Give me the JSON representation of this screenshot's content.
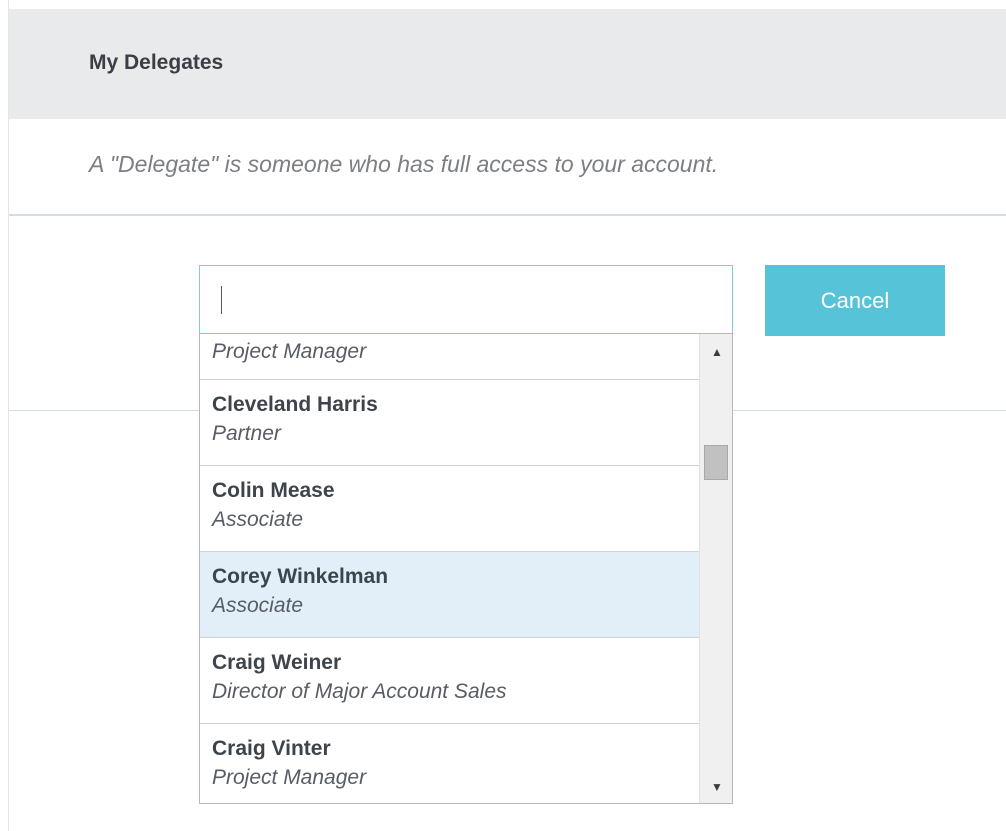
{
  "header": {
    "title": "My Delegates"
  },
  "description": "A \"Delegate\" is someone who has full access to your account.",
  "search": {
    "value": "",
    "placeholder": ""
  },
  "cancel_label": "Cancel",
  "dropdown": {
    "partial_item": {
      "role": "Project Manager"
    },
    "items": [
      {
        "name": "Cleveland Harris",
        "role": "Partner"
      },
      {
        "name": "Colin Mease",
        "role": "Associate"
      },
      {
        "name": "Corey Winkelman",
        "role": "Associate"
      },
      {
        "name": "Craig Weiner",
        "role": "Director of Major Account Sales"
      },
      {
        "name": "Craig Vinter",
        "role": "Project Manager"
      }
    ],
    "highlighted_index": 2
  },
  "scrollbar": {
    "up_arrow": "▲",
    "down_arrow": "▼"
  },
  "colors": {
    "header_bg": "#e9eaec",
    "cancel_button_bg": "#56c3d9",
    "highlight_bg": "#e2eff9",
    "input_border": "#86c7e2"
  }
}
